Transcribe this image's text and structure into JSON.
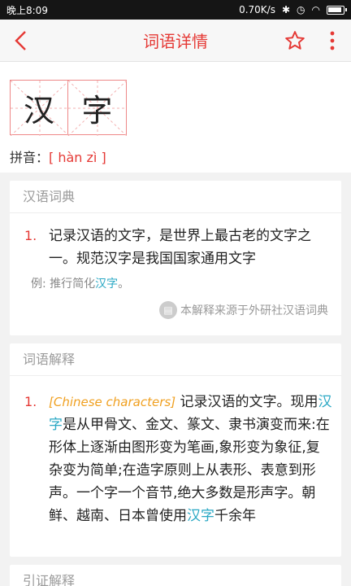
{
  "status_bar": {
    "time": "晚上8:09",
    "speed": "0.70K/s"
  },
  "toolbar": {
    "title": "词语详情"
  },
  "word": {
    "chars": [
      "汉",
      "字"
    ],
    "pinyin_label": "拼音：",
    "pinyin": "[ hàn zì ]"
  },
  "dictionary": {
    "title": "汉语词典",
    "definition_number": "1.",
    "definition": "记录汉语的文字，是世界上最古老的文字之一。规范汉字是我国国家通用文字",
    "example_prefix": "例: 推行简化",
    "example_highlight": "汉字",
    "example_suffix": "。",
    "source": "本解释来源于外研社汉语词典"
  },
  "explanation": {
    "title": "词语解释",
    "number": "1.",
    "english": "[Chinese characters]",
    "part1": " 记录汉语的文字。现用",
    "link1": "汉字",
    "part2": "是从甲骨文、金文、篆文、隶书演变而来:在形体上逐渐由图形变为笔画,象形变为象征,复杂变为简单;在造字原则上从表形、表意到形声。一个字一个音节,绝大多数是形声字。朝鲜、越南、日本曾使用",
    "link2": "汉字",
    "part3": "千余年"
  },
  "citation": {
    "title": "引证解释"
  }
}
